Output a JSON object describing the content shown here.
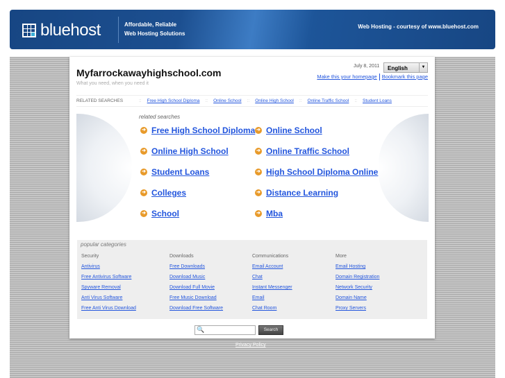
{
  "banner": {
    "brand": "bluehost",
    "tagline1": "Affordable, Reliable",
    "tagline2": "Web Hosting Solutions",
    "courtesy": "Web Hosting - courtesy of www.bluehost.com"
  },
  "header": {
    "title": "Myfarrockawayhighschool.com",
    "subtitle": "What you need, when you need it",
    "date": "July 8, 2011",
    "language": "English",
    "homepage": "Make this your homepage",
    "bookmark": "Bookmark this page"
  },
  "related_bar": {
    "label": "RELATED SEARCHES",
    "items": [
      "Free High School Diploma",
      "Online School",
      "Online High School",
      "Online Traffic School",
      "Student Loans"
    ]
  },
  "related": {
    "label": "related searches",
    "links": [
      "Free High School Diploma",
      "Online School",
      "Online High School",
      "Online Traffic School",
      "Student Loans",
      "High School Diploma Online",
      "Colleges",
      "Distance Learning",
      "School",
      "Mba"
    ]
  },
  "popular": {
    "label": "popular categories",
    "columns": [
      {
        "title": "Security",
        "links": [
          "Antivirus",
          "Free Antivirus Software",
          "Spyware Removal",
          "Anti Virus Software",
          "Free Anti Virus Download"
        ]
      },
      {
        "title": "Downloads",
        "links": [
          "Free Downloads",
          "Download Music",
          "Download Full Movie",
          "Free Music Download",
          "Download Free Software"
        ]
      },
      {
        "title": "Communications",
        "links": [
          "Email Account",
          "Chat",
          "Instant Messenger",
          "Email",
          "Chat Room"
        ]
      },
      {
        "title": "More",
        "links": [
          "Email Hosting",
          "Domain Registration",
          "Network Security",
          "Domain Name",
          "Proxy Servers"
        ]
      }
    ]
  },
  "search": {
    "button": "Search"
  },
  "footer": {
    "privacy": "Privacy Policy"
  }
}
